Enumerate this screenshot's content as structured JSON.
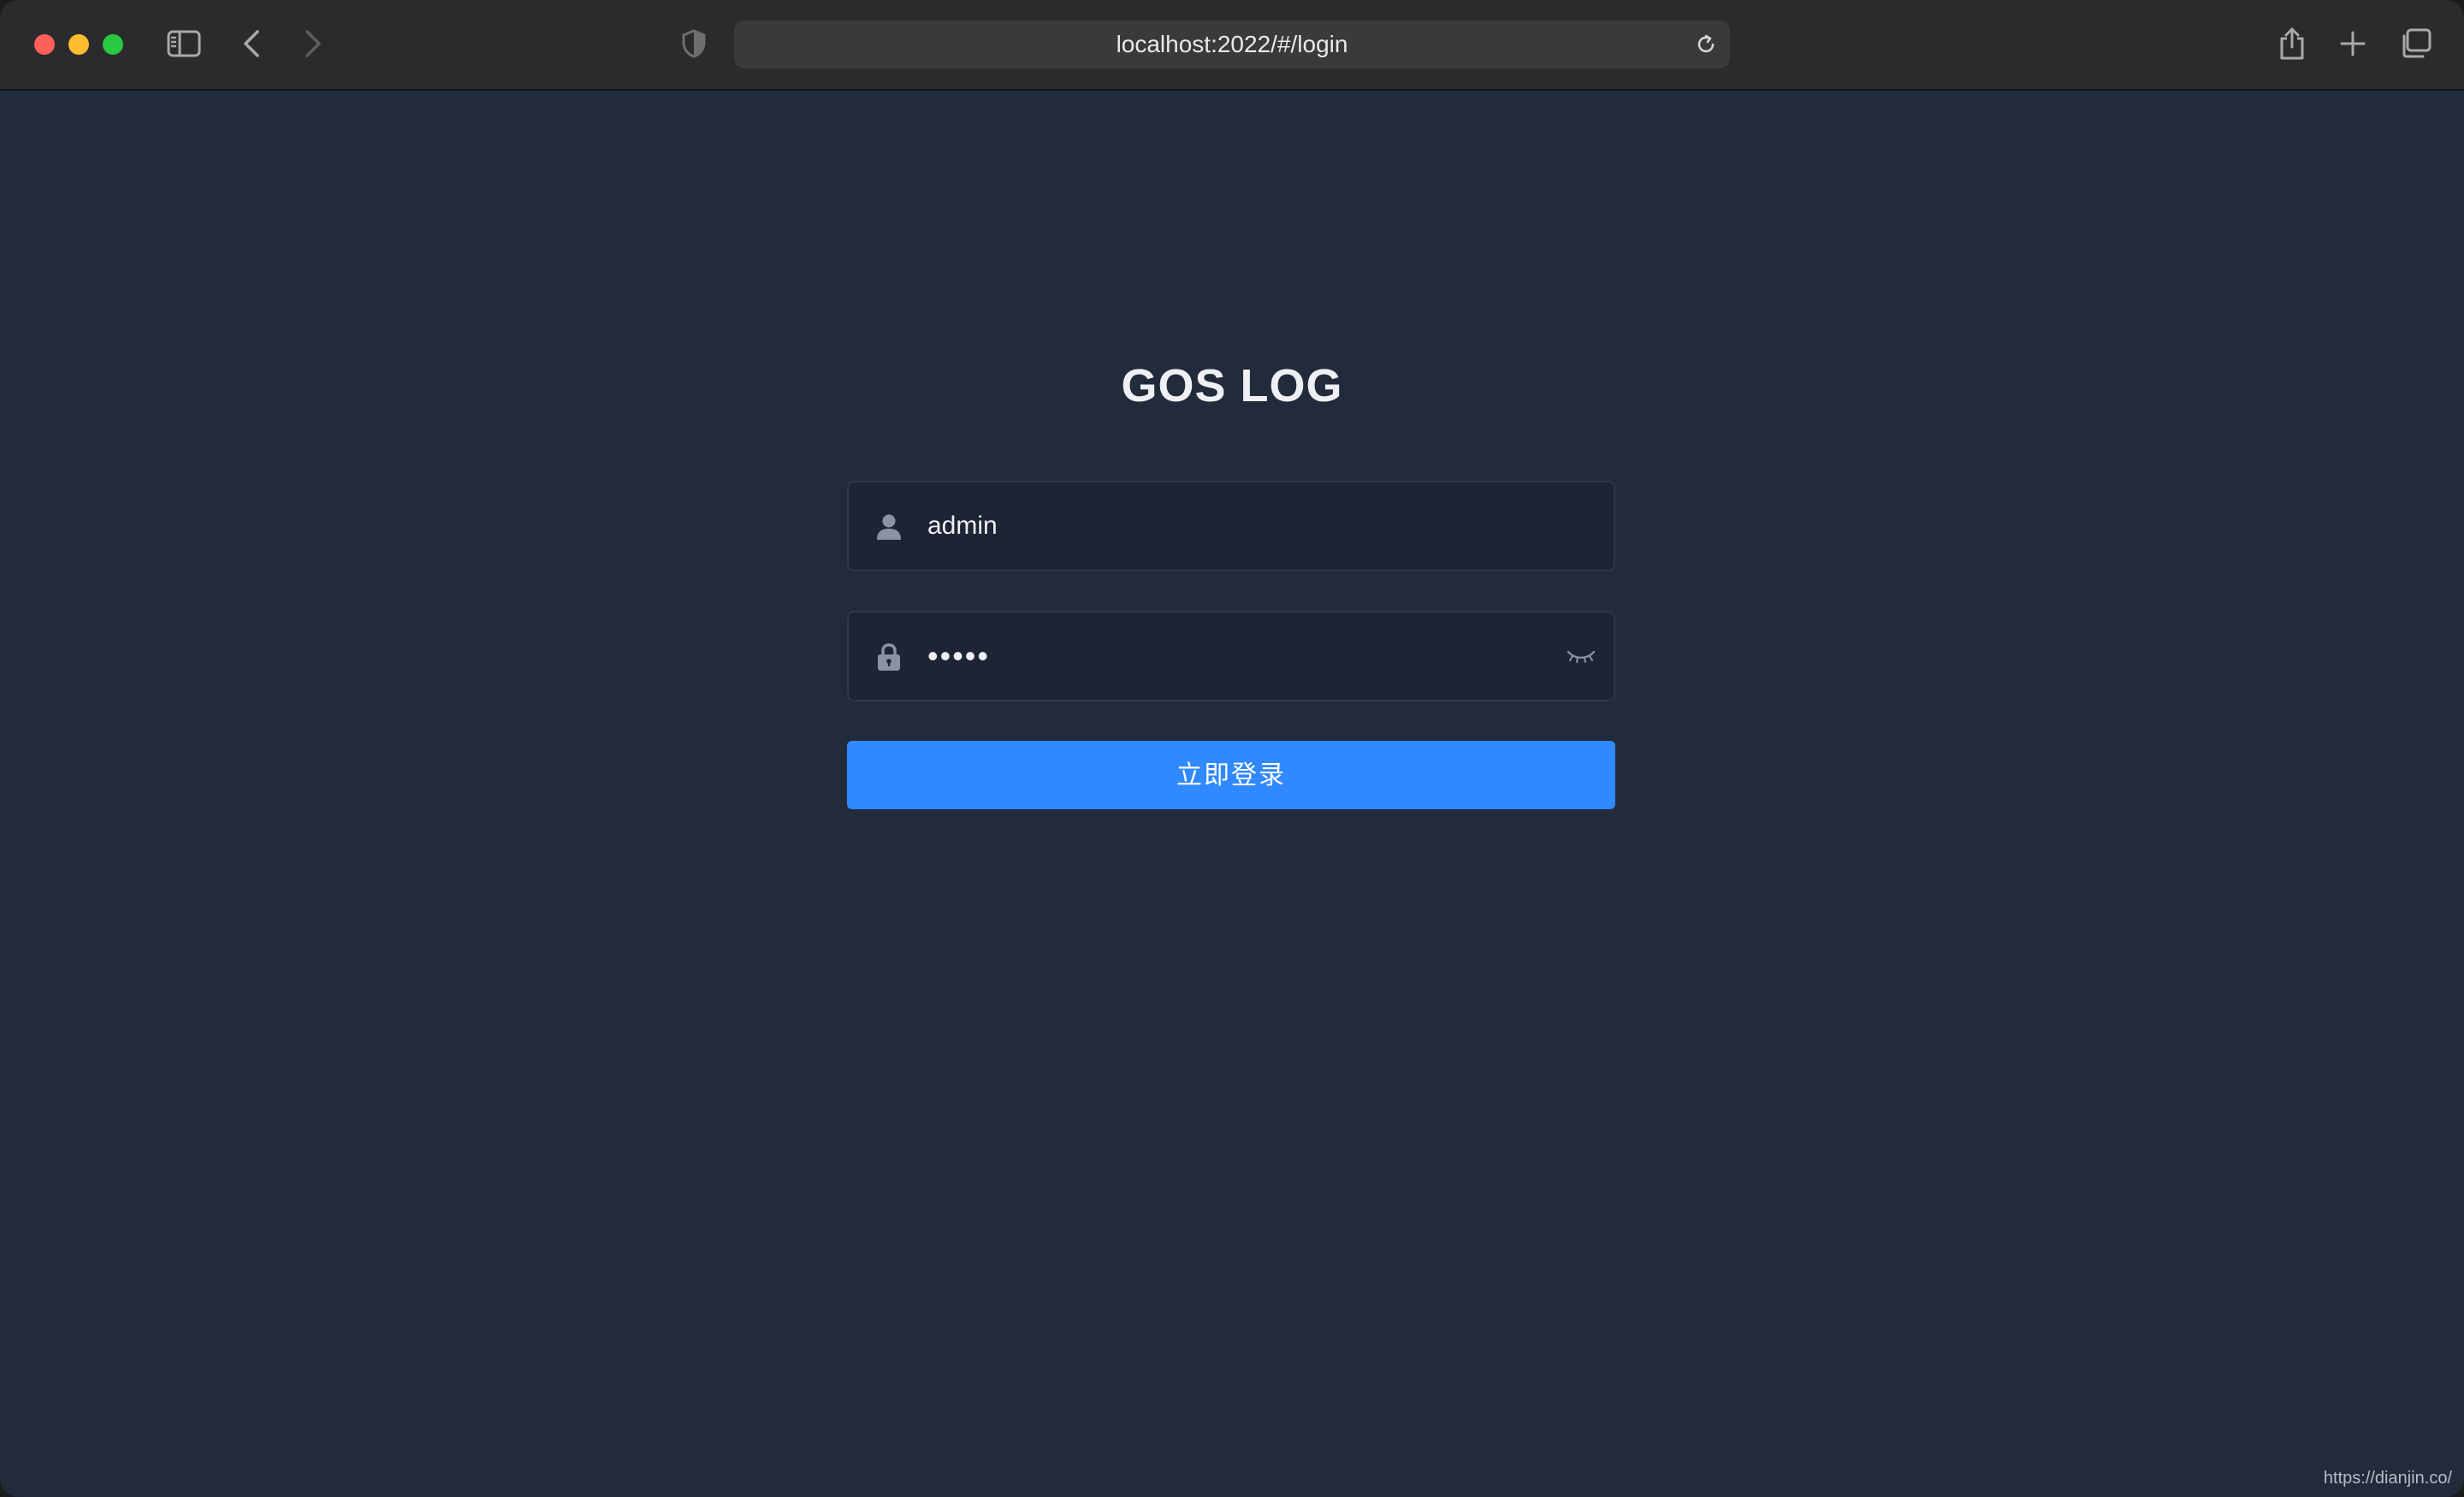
{
  "browser": {
    "url": "localhost:2022/#/login"
  },
  "login": {
    "title": "GOS LOG",
    "username_value": "admin",
    "password_value": "•••••",
    "submit_label": "立即登录"
  },
  "watermark": "https://dianjin.co/",
  "colors": {
    "page_background": "#222b3b",
    "field_background": "#1d2433",
    "button_primary": "#3089ff",
    "toolbar_background": "#2b2a2d"
  },
  "icons": {
    "username": "user-icon",
    "password": "lock-icon",
    "password_toggle": "eye-closed-icon"
  }
}
